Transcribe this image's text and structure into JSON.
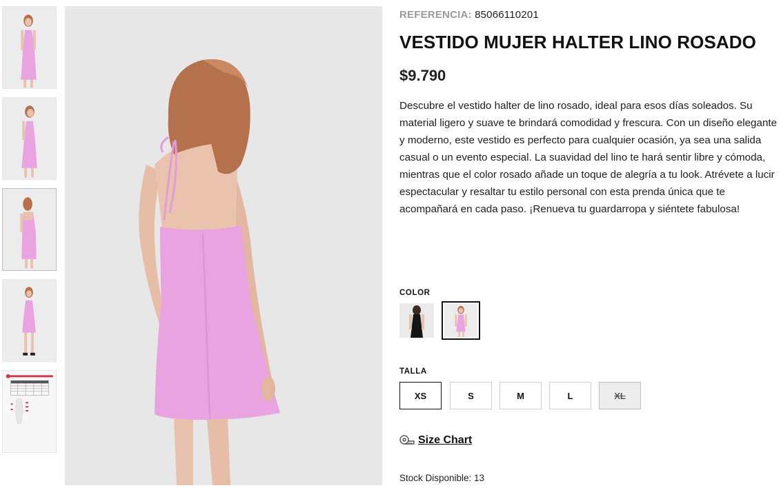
{
  "product": {
    "reference_label": "REFERENCIA:",
    "reference_value": "85066110201",
    "title": "VESTIDO MUJER HALTER LINO ROSADO",
    "price": "$9.790",
    "description": "Descubre el vestido halter de lino rosado, ideal para esos días soleados. Su material ligero y suave te brindará comodidad y frescura. Con un diseño elegante y moderno, este vestido es perfecto para cualquier ocasión, ya sea una salida casual o un evento especial. La suavidad del lino te hará sentir libre y cómoda, mientras que el color rosado añade un toque de alegría a tu look. Atrévete a lucir espectacular y resaltar tu estilo personal con esta prenda única que te acompañará en cada paso. ¡Renueva tu guardarropa y siéntete fabulosa!"
  },
  "gallery": {
    "thumbnails": [
      "front-view",
      "front-side-view",
      "back-view",
      "full-body-view",
      "size-chart"
    ],
    "active_index": 2
  },
  "color": {
    "label": "COLOR",
    "options": [
      "black-dress-swatch",
      "pink-dress-swatch"
    ],
    "selected": "pink-dress-swatch"
  },
  "size": {
    "label": "TALLA",
    "options": [
      "XS",
      "S",
      "M",
      "L",
      "XL"
    ],
    "selected": "XS",
    "unavailable": [
      "XL"
    ]
  },
  "size_chart": {
    "label": "Size Chart",
    "icon": "tape-measure-icon"
  },
  "stock": {
    "text": "Stock Disponible: 13"
  },
  "colors": {
    "dress_pink": "#e9a3e0",
    "background": "#e7e7e8",
    "hair": "#b4714c"
  }
}
